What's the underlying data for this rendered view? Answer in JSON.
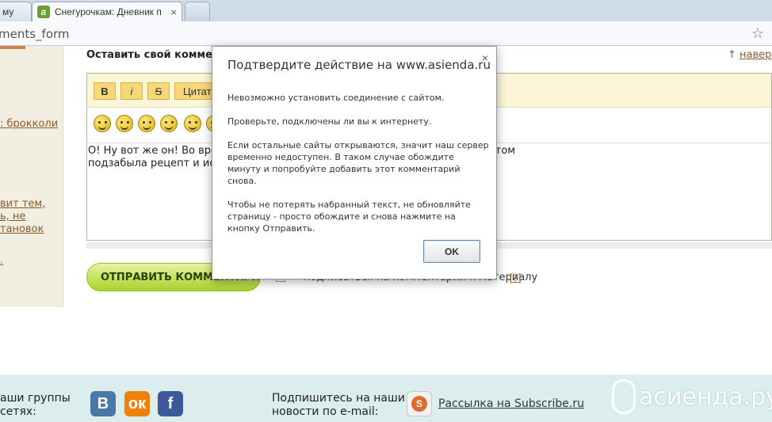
{
  "browser": {
    "tabs": [
      {
        "label": "му"
      },
      {
        "label": "Снегурочкам: Дневник п",
        "favicon": "a",
        "close": "×"
      },
      {
        "label": ""
      }
    ],
    "url": "ments_form",
    "bookmark_icon": "☆"
  },
  "sidebar": {
    "links": [
      ": брокколи",
      "вит тем,",
      "ь, не",
      "тановок",
      "."
    ]
  },
  "comment_form": {
    "title": "Оставить свой комментарий",
    "up_arrow": "↑",
    "up_label": "наверх",
    "toolbar": {
      "bold": "B",
      "italic": "i",
      "strike": "S",
      "quote": "Цитата"
    },
    "text_line1": "О! Ну вот же он! Во время                                                                                                                         и приторговывала  ею. И я научилась от нее. Потом",
    "text_line2": "подзабыла рецепт и иска",
    "submit_label": "ОТПРАВИТЬ КОММЕНТАРИЙ",
    "subscribe_label": "подписаться на комментарии к материалу",
    "help_label": "[?]"
  },
  "footer": {
    "groups_text_1": "аши группы",
    "groups_text_2": "сетях:",
    "vk": "В",
    "ok": "ок",
    "fb": "f",
    "subscribe_text_1": "Подпишитесь на наши",
    "subscribe_text_2": "новости по e-mail:",
    "subscribe_link": "Рассылка на Subscribe.ru",
    "brand": "асиенда.ру"
  },
  "dialog": {
    "title": "Подтвердите действие на www.asienda.ru",
    "close": "×",
    "p1": "Невозможно установить соединение с сайтом.",
    "p2": "Проверьте, подключены ли вы к интернету.",
    "p3": "Если остальные сайты открываются, значит наш сервер временно недоступен. В таком случае обождите минуту и попробуйте добавить этот комментарий снова.",
    "p4": "Чтобы не потерять набранный текст, не обновляйте страницу - просто обождите и снова нажмите на кнопку Отправить.",
    "ok": "OK"
  }
}
